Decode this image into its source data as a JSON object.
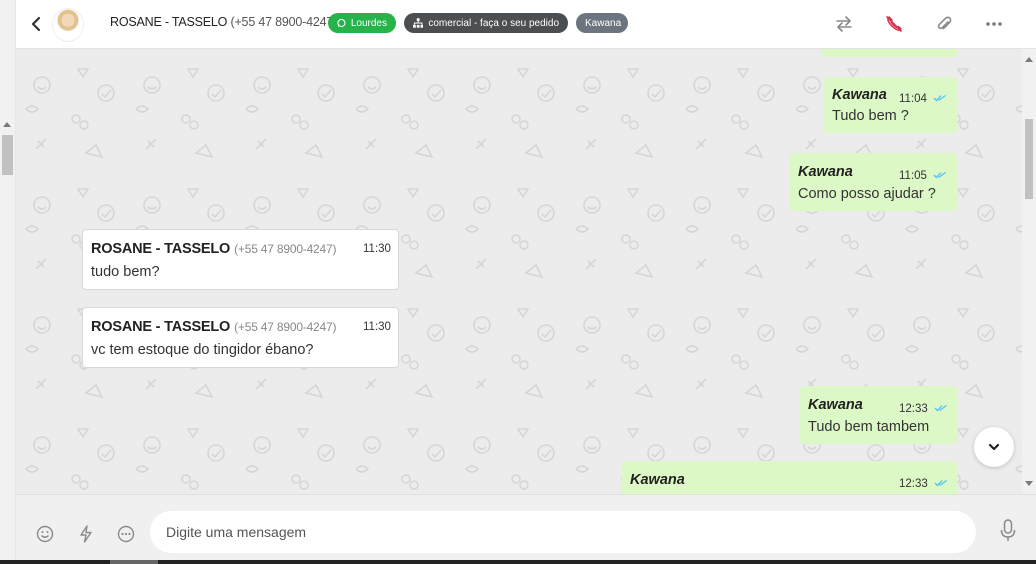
{
  "header": {
    "contact_name": "ROSANE - TASSELO",
    "contact_phone": "(+55 47 8900-4247)",
    "tags": [
      {
        "label": "Lourdes",
        "icon": "whatsapp-icon",
        "color": "#25b34a"
      },
      {
        "label": "comercial - faça o seu pedido",
        "icon": "sitemap-icon",
        "color": "#4b4f52"
      },
      {
        "label": "Kawana",
        "color": "#6c757d"
      }
    ]
  },
  "messages": [
    {
      "direction": "out",
      "sender": "Kawana",
      "time": "11:04",
      "text": "Tudo bem ?"
    },
    {
      "direction": "out",
      "sender": "Kawana",
      "time": "11:05",
      "text": "Como posso ajudar ?"
    },
    {
      "direction": "in",
      "sender": "ROSANE - TASSELO",
      "phone": "(+55 47 8900-4247)",
      "time": "11:30",
      "text": "tudo bem?"
    },
    {
      "direction": "in",
      "sender": "ROSANE - TASSELO",
      "phone": "(+55 47 8900-4247)",
      "time": "11:30",
      "text": "vc tem estoque do tingidor ébano?"
    },
    {
      "direction": "out",
      "sender": "Kawana",
      "time": "12:33",
      "text": "Tudo bem tambem"
    },
    {
      "direction": "out",
      "sender": "Kawana",
      "time": "12:33",
      "text": ""
    }
  ],
  "composer": {
    "placeholder": "Digite uma mensagem"
  },
  "colors": {
    "outgoing_bubble": "#dcf8c6",
    "incoming_bubble": "#ffffff",
    "read_ticks": "#4fc3f7",
    "chat_background": "#ececec"
  }
}
